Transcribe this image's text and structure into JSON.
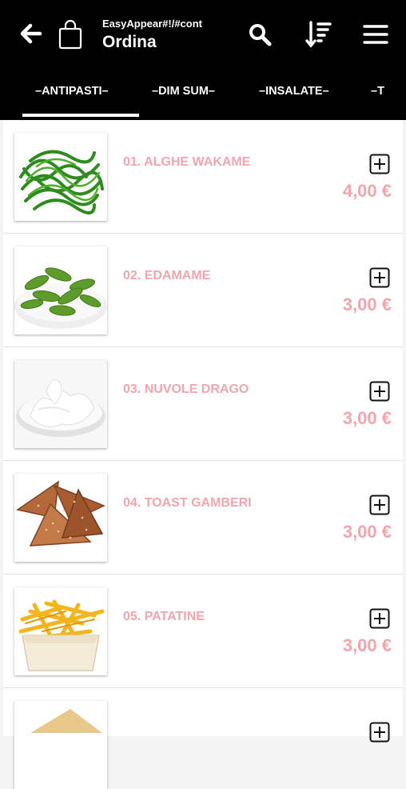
{
  "header": {
    "subtitle": "EasyAppear#!/#cont",
    "title": "Ordina",
    "icons": [
      "arrow-left-icon",
      "shopping-bag-icon",
      "search-icon",
      "sort-descending-icon",
      "hamburger-menu-icon"
    ]
  },
  "tabs": [
    {
      "label": "–ANTIPASTI–",
      "active": true
    },
    {
      "label": "–DIM SUM–",
      "active": false
    },
    {
      "label": "–INSALATE–",
      "active": false
    },
    {
      "label": "–T",
      "active": false
    }
  ],
  "colors": {
    "accent": "#f2a5ac",
    "header_bg": "#000000"
  },
  "products": [
    {
      "name": "01. ALGHE WAKAME",
      "price": "4,00 €",
      "image": "seaweed"
    },
    {
      "name": "02. EDAMAME",
      "price": "3,00 €",
      "image": "edamame"
    },
    {
      "name": "03. NUVOLE DRAGO",
      "price": "3,00 €",
      "image": "prawn-crackers"
    },
    {
      "name": "04. TOAST GAMBERI",
      "price": "3,00 €",
      "image": "shrimp-toast"
    },
    {
      "name": "05. PATATINE",
      "price": "3,00 €",
      "image": "fries"
    }
  ]
}
